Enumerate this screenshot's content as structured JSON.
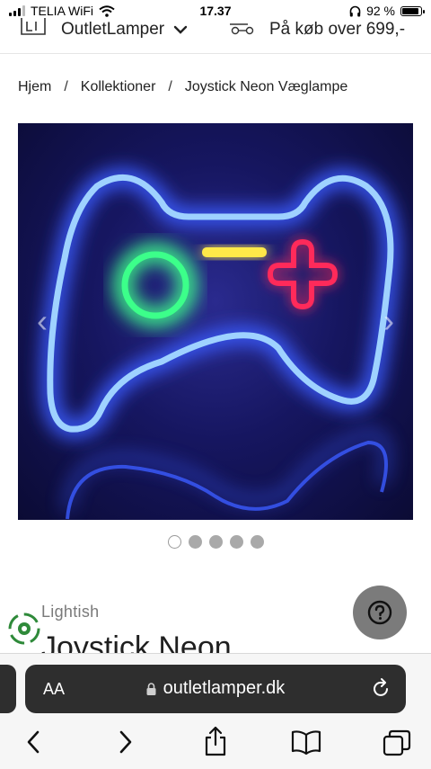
{
  "status_bar": {
    "carrier": "TELIA WiFi",
    "time": "17.37",
    "battery": "92 %"
  },
  "header": {
    "store_name": "OutletLamper",
    "promo": "På køb over 699,-"
  },
  "breadcrumb": [
    "Hjem",
    "Kollektioner",
    "Joystick Neon Væglampe"
  ],
  "breadcrumb_separator": "/",
  "gallery": {
    "slide_count": 5,
    "active_slide": 1,
    "neon_colors": {
      "controller": "#9fd2ff",
      "glow": "#3b5bff",
      "ring": "#3cff8a",
      "bar": "#ffe94a",
      "dpad": "#ff2a5a"
    }
  },
  "product": {
    "brand": "Lightish",
    "title": "Joystick Neon"
  },
  "browser": {
    "aa_label": "AA",
    "url": "outletlamper.dk"
  }
}
